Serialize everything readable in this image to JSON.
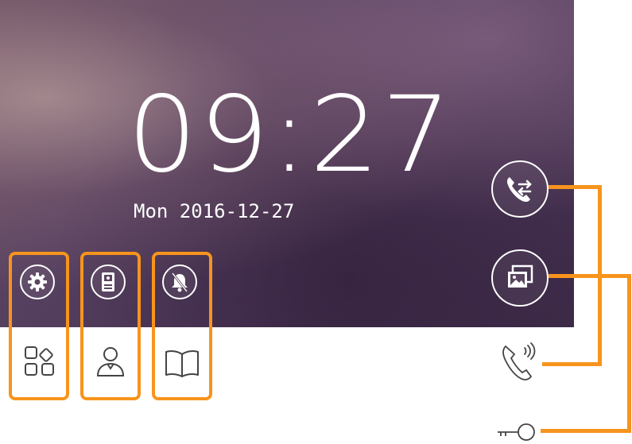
{
  "screen": {
    "clock": "09:27",
    "date": "Mon 2016-12-27"
  },
  "left_buttons": [
    {
      "name": "settings",
      "icon": "gear-icon"
    },
    {
      "name": "monitor",
      "icon": "door-station-icon"
    },
    {
      "name": "do-not-disturb",
      "icon": "bell-muted-icon"
    }
  ],
  "right_buttons": [
    {
      "name": "intercom",
      "icon": "phone-transfer-icon"
    },
    {
      "name": "gallery",
      "icon": "photos-icon"
    }
  ],
  "legend_icons": [
    {
      "name": "apps",
      "icon": "apps-grid-icon"
    },
    {
      "name": "user",
      "icon": "user-icon"
    },
    {
      "name": "book",
      "icon": "open-book-icon"
    },
    {
      "name": "call",
      "icon": "ringing-phone-icon"
    },
    {
      "name": "unlock",
      "icon": "key-icon"
    }
  ],
  "colors": {
    "accent": "#f7941d",
    "screen_dark": "#4c3757",
    "text": "#ffffff",
    "icon_line": "#444444"
  }
}
